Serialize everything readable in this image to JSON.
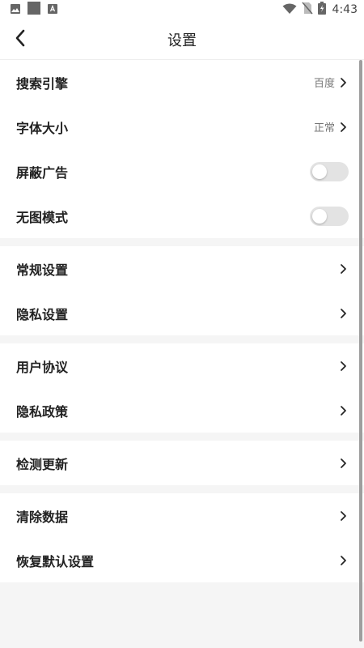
{
  "status_bar": {
    "time": "4:43",
    "left_icons": [
      "image-icon",
      "square-icon",
      "font-icon"
    ],
    "right_icons": [
      "wifi-icon",
      "no-sim-icon",
      "battery-charging-icon"
    ]
  },
  "app_bar": {
    "title": "设置",
    "back_icon": "chevron-left-icon"
  },
  "sections": [
    {
      "items": [
        {
          "label": "搜索引擎",
          "value": "百度",
          "type": "link"
        },
        {
          "label": "字体大小",
          "value": "正常",
          "type": "link"
        },
        {
          "label": "屏蔽广告",
          "type": "toggle",
          "checked": false
        },
        {
          "label": "无图模式",
          "type": "toggle",
          "checked": false
        }
      ]
    },
    {
      "items": [
        {
          "label": "常规设置",
          "type": "link"
        },
        {
          "label": "隐私设置",
          "type": "link"
        }
      ]
    },
    {
      "items": [
        {
          "label": "用户协议",
          "type": "link"
        },
        {
          "label": "隐私政策",
          "type": "link"
        }
      ]
    },
    {
      "items": [
        {
          "label": "检测更新",
          "type": "link"
        }
      ]
    },
    {
      "items": [
        {
          "label": "清除数据",
          "type": "link"
        },
        {
          "label": "恢复默认设置",
          "type": "link"
        }
      ]
    }
  ],
  "colors": {
    "background": "#f5f5f5",
    "surface": "#ffffff",
    "text": "#222222",
    "secondary_text": "#777777",
    "toggle_off": "#e3e3e3"
  }
}
